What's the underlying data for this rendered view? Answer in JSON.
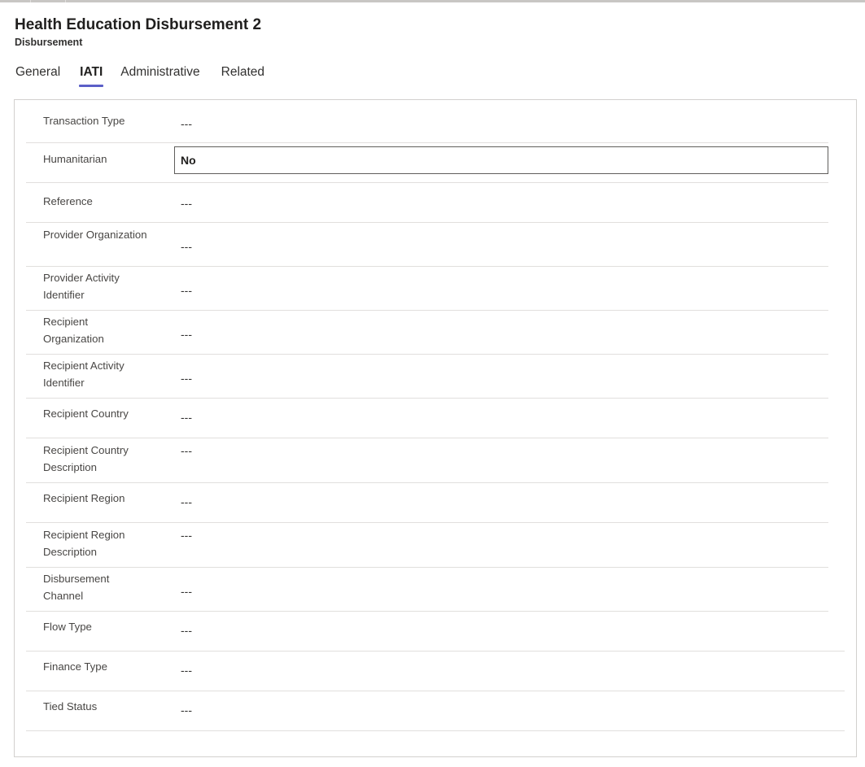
{
  "record": {
    "title": "Health Education Disbursement 2",
    "entity_type": "Disbursement"
  },
  "tabs": [
    {
      "label": "General",
      "active": false
    },
    {
      "label": "IATI",
      "active": true
    },
    {
      "label": "Administrative",
      "active": false
    },
    {
      "label": "Related",
      "active": false
    }
  ],
  "colors": {
    "active_tab_underline": "#5b5fc7",
    "row_divider": "#e1dfdd",
    "panel_border": "#d2d0ce"
  },
  "fields": [
    {
      "label": "Transaction Type",
      "value": "---"
    },
    {
      "label": "Humanitarian",
      "value": "No"
    },
    {
      "label": "Reference",
      "value": "---"
    },
    {
      "label": "Provider Organization",
      "value": "---"
    },
    {
      "label": "Provider Activity Identifier",
      "value": "---"
    },
    {
      "label": "Recipient Organization",
      "value": "---"
    },
    {
      "label": "Recipient Activity Identifier",
      "value": "---"
    },
    {
      "label": "Recipient Country",
      "value": "---"
    },
    {
      "label": "Recipient Country Description",
      "value": "---"
    },
    {
      "label": "Recipient Region",
      "value": "---"
    },
    {
      "label": "Recipient Region Description",
      "value": "---"
    },
    {
      "label": "Disbursement Channel",
      "value": "---"
    },
    {
      "label": "Flow Type",
      "value": "---"
    },
    {
      "label": "Finance Type",
      "value": "---"
    },
    {
      "label": "Tied Status",
      "value": "---"
    }
  ]
}
